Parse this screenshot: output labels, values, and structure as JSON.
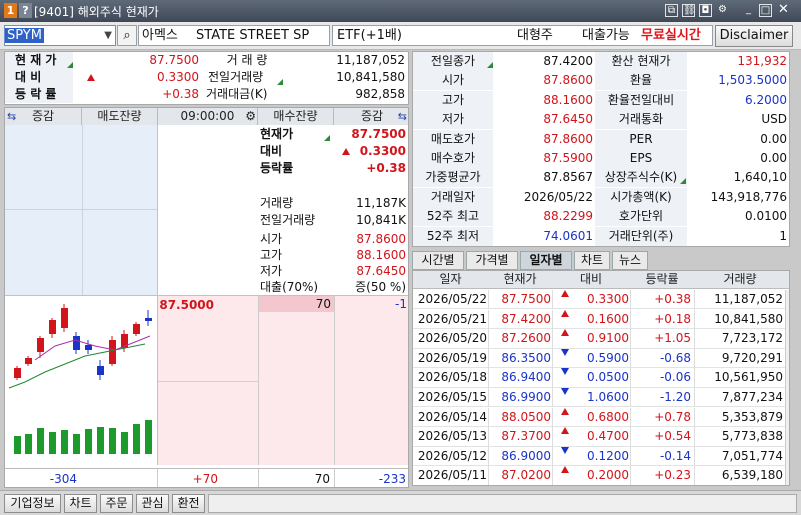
{
  "window": {
    "badge1": "1",
    "badge2": "?",
    "title": "[9401] 해외주식 현재가",
    "icons": [
      "copy-icon",
      "link-icon",
      "camera-icon",
      "gear-icon",
      "minimize-icon",
      "maximize-icon",
      "close-icon"
    ]
  },
  "toolbar": {
    "symbol": "SPYM",
    "exchange": "아멕스",
    "name": "STATE STREET SP",
    "etf_type": "ETF(+1배)",
    "type": "대형주",
    "loan": "대출가능",
    "realtime": "무료실시간",
    "disclaimer": "Disclaimer"
  },
  "quote": {
    "price_label": "현 재 가",
    "price": "87.7500",
    "change_label": "대    비",
    "change": "0.3300",
    "rate_label": "등 락 률",
    "rate": "+0.38",
    "volume_label": "거 래 량",
    "volume": "11,187,052",
    "prev_volume_label": "전일거래량",
    "prev_volume": "10,841,580",
    "amount_label": "거래대금(K)",
    "amount": "982,858"
  },
  "orderbook": {
    "headers": [
      "증감",
      "매도잔량",
      "09:00:00",
      "매수잔량",
      "증감"
    ],
    "summary": {
      "price_label": "현재가",
      "price": "87.7500",
      "change_label": "대비",
      "change": "0.3300",
      "rate_label": "등락률",
      "rate": "+0.38",
      "volume_label": "거래량",
      "volume": "11,187K",
      "prev_volume_label": "전일거래량",
      "prev_volume": "10,841K",
      "open_label": "시가",
      "open": "87.8600",
      "high_label": "고가",
      "high": "88.1600",
      "low_label": "저가",
      "low": "87.6450",
      "loan_label": "대출(70%)",
      "margin_label": "증(50 %)"
    },
    "bid_price": "87.5000",
    "bid_qty": "70",
    "bid_change": "-1",
    "total_ask_change": "-304",
    "total_ask": "+70",
    "total_bid": "70",
    "total_bid_change": "-233"
  },
  "detail": {
    "rows": [
      {
        "l1": "전일종가",
        "v1": "87.4200",
        "c1": "black",
        "l2": "환산 현재가",
        "v2": "131,932",
        "c2": "red"
      },
      {
        "l1": "시가",
        "v1": "87.8600",
        "c1": "red",
        "l2": "환율",
        "v2": "1,503.5000",
        "c2": "blue"
      },
      {
        "l1": "고가",
        "v1": "88.1600",
        "c1": "red",
        "l2": "환율전일대비",
        "v2": "6.2000",
        "c2": "blue"
      },
      {
        "l1": "저가",
        "v1": "87.6450",
        "c1": "red",
        "l2": "거래통화",
        "v2": "USD",
        "c2": "black"
      },
      {
        "l1": "매도호가",
        "v1": "87.8600",
        "c1": "red",
        "l2": "PER",
        "v2": "0.00",
        "c2": "black"
      },
      {
        "l1": "매수호가",
        "v1": "87.5900",
        "c1": "red",
        "l2": "EPS",
        "v2": "0.00",
        "c2": "black"
      },
      {
        "l1": "가중평균가",
        "v1": "87.8567",
        "c1": "black",
        "l2": "상장주식수(K)",
        "v2": "1,640,10",
        "c2": "black"
      },
      {
        "l1": "거래일자",
        "v1": "2026/05/22",
        "c1": "black",
        "l2": "시가총액(K)",
        "v2": "143,918,776",
        "c2": "black"
      },
      {
        "l1": "52주 최고",
        "v1": "88.2299",
        "c1": "red",
        "l2": "호가단위",
        "v2": "0.0100",
        "c2": "black"
      },
      {
        "l1": "52주 최저",
        "v1": "74.0601",
        "c1": "blue",
        "l2": "거래단위(주)",
        "v2": "1",
        "c2": "black"
      }
    ]
  },
  "tabs": [
    "시간별",
    "가격별",
    "일자별",
    "차트",
    "뉴스"
  ],
  "active_tab": 2,
  "daily": {
    "headers": [
      "일자",
      "현재가",
      "대비",
      "등락률",
      "거래량"
    ],
    "rows": [
      {
        "date": "2026/05/22",
        "price": "87.7500",
        "dir": "up",
        "change": "0.3300",
        "rate": "+0.38",
        "volume": "11,187,052"
      },
      {
        "date": "2026/05/21",
        "price": "87.4200",
        "dir": "up",
        "change": "0.1600",
        "rate": "+0.18",
        "volume": "10,841,580"
      },
      {
        "date": "2026/05/20",
        "price": "87.2600",
        "dir": "up",
        "change": "0.9100",
        "rate": "+1.05",
        "volume": "7,723,172"
      },
      {
        "date": "2026/05/19",
        "price": "86.3500",
        "dir": "down",
        "change": "0.5900",
        "rate": "-0.68",
        "volume": "9,720,291"
      },
      {
        "date": "2026/05/18",
        "price": "86.9400",
        "dir": "down",
        "change": "0.0500",
        "rate": "-0.06",
        "volume": "10,561,950"
      },
      {
        "date": "2026/05/15",
        "price": "86.9900",
        "dir": "down",
        "change": "1.0600",
        "rate": "-1.20",
        "volume": "7,877,234"
      },
      {
        "date": "2026/05/14",
        "price": "88.0500",
        "dir": "up",
        "change": "0.6800",
        "rate": "+0.78",
        "volume": "5,353,879"
      },
      {
        "date": "2026/05/13",
        "price": "87.3700",
        "dir": "up",
        "change": "0.4700",
        "rate": "+0.54",
        "volume": "5,773,838"
      },
      {
        "date": "2026/05/12",
        "price": "86.9000",
        "dir": "down",
        "change": "0.1200",
        "rate": "-0.14",
        "volume": "7,051,774"
      },
      {
        "date": "2026/05/11",
        "price": "87.0200",
        "dir": "up",
        "change": "0.2000",
        "rate": "+0.23",
        "volume": "6,539,180"
      }
    ]
  },
  "bottom": [
    "기업정보",
    "차트",
    "주문",
    "관심",
    "환전"
  ],
  "colors": {
    "up": "#d2141b",
    "down": "#1a33c8",
    "title": "#4b5563"
  }
}
